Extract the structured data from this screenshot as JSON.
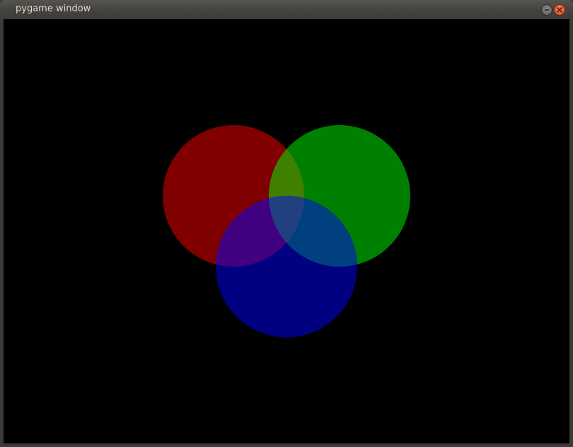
{
  "window": {
    "title": "pygame window"
  },
  "buttons": {
    "minimize_icon": "minimize-icon",
    "close_icon": "close-icon"
  },
  "colors": {
    "canvas_background": "#000000",
    "red_circle": "#800000",
    "green_circle": "#008000",
    "blue_circle": "#000080",
    "red_green_overlap": "#408000",
    "red_blue_overlap": "#400080",
    "green_blue_overlap": "#004080",
    "center_overlap": "#204080"
  }
}
